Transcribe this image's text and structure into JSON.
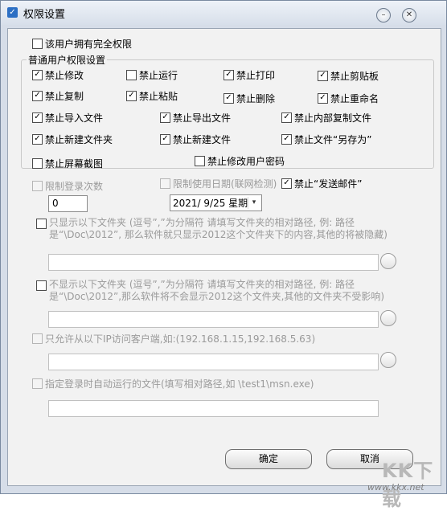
{
  "window": {
    "title": "权限设置"
  },
  "full_permission": {
    "label": "该用户拥有完全权限",
    "checked": false
  },
  "group": {
    "legend": "普通用户权限设置",
    "items": [
      {
        "label": "禁止修改",
        "checked": true
      },
      {
        "label": "禁止运行",
        "checked": false
      },
      {
        "label": "禁止打印",
        "checked": true
      },
      {
        "label": "禁止剪贴板",
        "checked": true
      },
      {
        "label": "禁止复制",
        "checked": true
      },
      {
        "label": "禁止粘贴",
        "checked": true
      },
      {
        "label": "禁止删除",
        "checked": true
      },
      {
        "label": "禁止重命名",
        "checked": true
      },
      {
        "label": "禁止导入文件",
        "checked": true
      },
      {
        "label": "禁止导出文件",
        "checked": true
      },
      {
        "label": "禁止内部复制文件",
        "checked": true
      },
      {
        "label": "禁止新建文件夹",
        "checked": true
      },
      {
        "label": "禁止新建文件",
        "checked": true
      },
      {
        "label": "禁止文件“另存为”",
        "checked": true
      }
    ]
  },
  "screenshot": {
    "label": "禁止屏幕截图",
    "checked": false
  },
  "modify_password": {
    "label": "禁止修改用户密码",
    "checked": false
  },
  "login_limit": {
    "label": "限制登录次数",
    "checked": false,
    "value": "0"
  },
  "date_limit": {
    "label": "限制使用日期(联网检测)",
    "checked": false,
    "date": "2021/  9/25 星期"
  },
  "send_mail": {
    "label": "禁止“发送邮件”",
    "checked": true
  },
  "show_only": {
    "label": "只显示以下文件夹 (逗号”,”为分隔符 请填写文件夹的相对路径, 例: 路径是“\\Doc\\2012”, 那么软件就只显示2012这个文件夹下的内容,其他的将被隐藏)",
    "checked": false,
    "value": ""
  },
  "hide": {
    "label": "不显示以下文件夹 (逗号”,”为分隔符 请填写文件夹的相对路径, 例: 路径是“\\Doc\\2012”,那么软件将不会显示2012这个文件夹,其他的文件夹不受影响)",
    "checked": false,
    "value": ""
  },
  "ip_allow": {
    "label": "只允许从以下IP访问客户端,如:(192.168.1.15,192.168.5.63)",
    "checked": false,
    "value": ""
  },
  "autorun": {
    "label": "指定登录时自动运行的文件(填写相对路径,如 \\test1\\msn.exe)",
    "checked": false,
    "value": ""
  },
  "buttons": {
    "ok": "确定",
    "cancel": "取消"
  },
  "watermark": {
    "logo": "KK下载",
    "url": "www.kkx.net"
  },
  "icons": {
    "check": "✓",
    "minimize": "○",
    "close": "✕",
    "dropdown": "chevron-down-icon"
  }
}
